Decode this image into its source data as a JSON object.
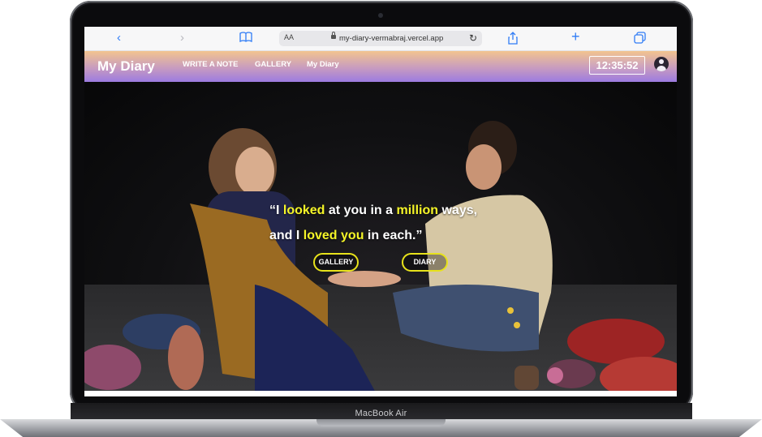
{
  "device": {
    "model_label": "MacBook Air"
  },
  "browser": {
    "back_icon": "‹",
    "forward_icon": "›",
    "book_icon": "book-icon",
    "aa_label": "AA",
    "url": "my-diary-vermabraj.vercel.app",
    "reload_icon": "↻",
    "share_icon": "share-icon",
    "new_tab_icon": "+",
    "tabs_icon": "tabs-icon"
  },
  "nav": {
    "brand": "My Diary",
    "links": [
      "WRITE A NOTE",
      "GALLERY",
      "My Diary"
    ],
    "clock": "12:35:52",
    "account_icon": "account-icon"
  },
  "hero": {
    "quote_line1": [
      "“I ",
      "looked",
      " at you in a ",
      "million",
      " ways,"
    ],
    "quote_line2": [
      "and I ",
      "loved you",
      " in each.”"
    ],
    "buttons": [
      "GALLERY",
      "DIARY"
    ]
  },
  "colors": {
    "accent_yellow": "#f5f528",
    "nav_gradient_top": "#f2c48f",
    "nav_gradient_bottom": "#9c7be0",
    "browser_blue": "#2f7cf6"
  }
}
